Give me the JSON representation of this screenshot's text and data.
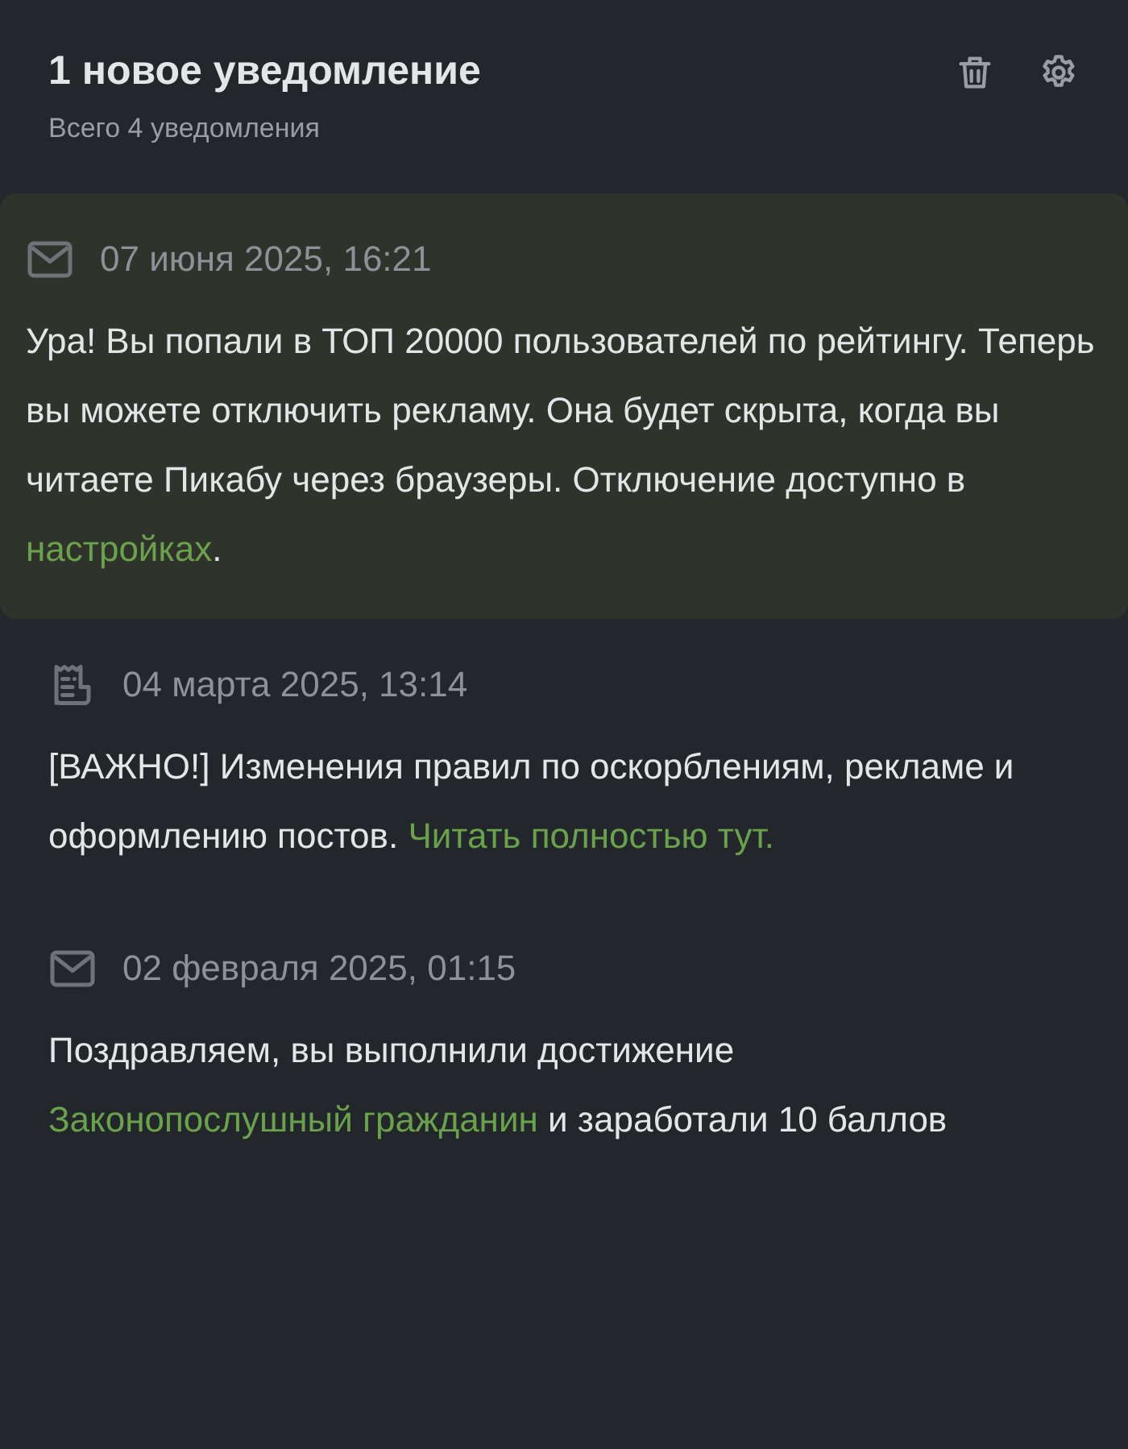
{
  "header": {
    "title": "1 новое уведомление",
    "subtitle": "Всего 4 уведомления"
  },
  "notifications": [
    {
      "kind": "mail",
      "unread": true,
      "date": "07 июня 2025, 16:21",
      "parts": [
        {
          "text": "Ура! Вы попали в ТОП 20000 пользователей по рейтингу. Теперь вы можете отключить рекламу. Она будет скрыта, когда вы читаете Пикабу через браузеры. Отключение доступно в ",
          "link": false
        },
        {
          "text": "настройках",
          "link": true
        },
        {
          "text": ".",
          "link": false
        }
      ]
    },
    {
      "kind": "news",
      "unread": false,
      "date": "04 марта 2025, 13:14",
      "parts": [
        {
          "text": "[ВАЖНО!] Изменения правил по оскорблениям, рекламе и оформлению постов. ",
          "link": false
        },
        {
          "text": "Читать полностью тут.",
          "link": true
        }
      ]
    },
    {
      "kind": "mail",
      "unread": false,
      "date": "02 февраля 2025, 01:15",
      "parts": [
        {
          "text": "Поздравляем, вы выполнили достижение ",
          "link": false
        },
        {
          "text": "Законопослушный гражданин",
          "link": true
        },
        {
          "text": " и заработали 10 баллов",
          "link": false
        }
      ]
    }
  ]
}
